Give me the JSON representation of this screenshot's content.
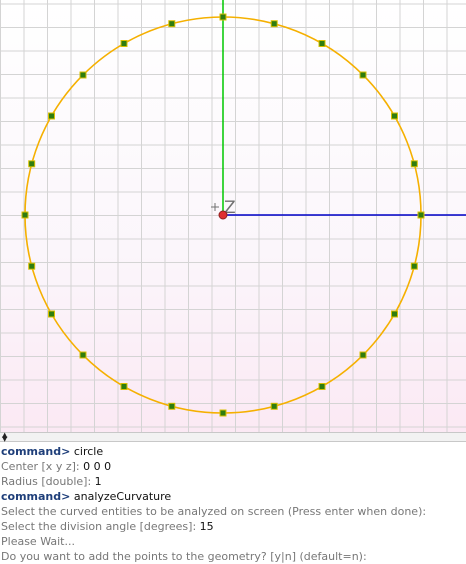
{
  "viewport": {
    "axis_label": "Z",
    "colors": {
      "grid": "#d4d4d4",
      "circle": "#f5b000",
      "point_fill": "#2f7d10",
      "point_border": "#d8c000",
      "x_axis": "#0000c8",
      "y_axis": "#00c800",
      "origin": "#e03030",
      "cross": "#707070"
    },
    "division_angle_degrees": 15
  },
  "splitter": {
    "icon": "up-down-arrows-icon",
    "glyph": "▲\n▼"
  },
  "console": {
    "lines": [
      {
        "kind": "prompt",
        "prompt": "command>",
        "text": "circle"
      },
      {
        "kind": "out",
        "text": "Center [x y z]:",
        "value": "0 0 0"
      },
      {
        "kind": "out",
        "text": "Radius [double]:",
        "value": "1"
      },
      {
        "kind": "prompt",
        "prompt": "command>",
        "text": "analyzeCurvature"
      },
      {
        "kind": "out",
        "text": "Select the curved entities to be analyzed on screen (Press enter when done):",
        "value": ""
      },
      {
        "kind": "out",
        "text": "Select the division angle [degrees]:",
        "value": "15"
      },
      {
        "kind": "out",
        "text": "Please Wait...",
        "value": ""
      },
      {
        "kind": "out",
        "text": "Do you want to add the points to the geometry? [y|n] (default=n):",
        "value": ""
      }
    ]
  }
}
